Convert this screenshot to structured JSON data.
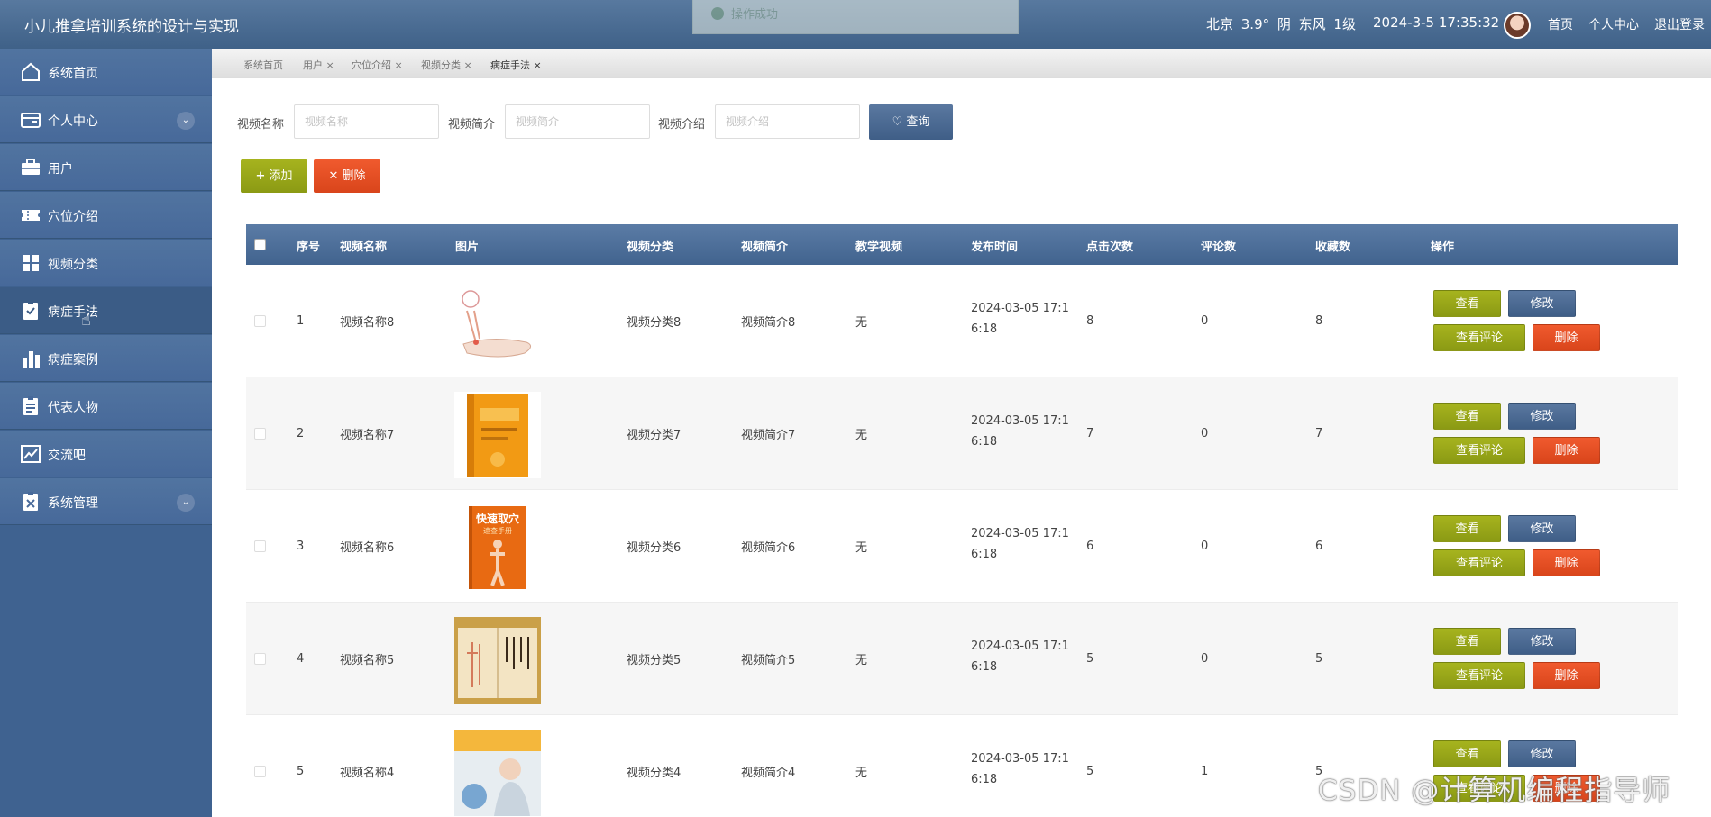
{
  "header": {
    "title": "小儿推拿培训系统的设计与实现",
    "toast": "操作成功",
    "weather": "北京 3.9° 阴 东风 1级",
    "datetime": "2024-3-5 17:35:32",
    "links": [
      "首页",
      "个人中心",
      "退出登录"
    ]
  },
  "sidebar": {
    "items": [
      {
        "label": "系统首页",
        "icon": "home-icon"
      },
      {
        "label": "个人中心",
        "icon": "wallet-icon",
        "expandable": true
      },
      {
        "label": "用户",
        "icon": "briefcase-icon"
      },
      {
        "label": "穴位介绍",
        "icon": "ticket-icon"
      },
      {
        "label": "视频分类",
        "icon": "grid-icon"
      },
      {
        "label": "病症手法",
        "icon": "clipboard-check-icon",
        "active": true
      },
      {
        "label": "病症案例",
        "icon": "bar-chart-icon"
      },
      {
        "label": "代表人物",
        "icon": "clipboard-list-icon"
      },
      {
        "label": "交流吧",
        "icon": "trend-icon"
      },
      {
        "label": "系统管理",
        "icon": "clipboard-x-icon",
        "expandable": true
      }
    ]
  },
  "tabs": [
    "系统首页",
    "用户 ×",
    "穴位介绍 ×",
    "视频分类 ×",
    "病症手法 ×"
  ],
  "search": {
    "fields": [
      {
        "label": "视频名称",
        "placeholder": "视频名称"
      },
      {
        "label": "视频简介",
        "placeholder": "视频简介"
      },
      {
        "label": "视频介绍",
        "placeholder": "视频介绍"
      }
    ],
    "query_label": "查询"
  },
  "actions": {
    "add_label": "添加",
    "delete_label": "删除"
  },
  "table": {
    "headers": [
      "序号",
      "视频名称",
      "图片",
      "视频分类",
      "视频简介",
      "教学视频",
      "发布时间",
      "点击次数",
      "评论数",
      "收藏数",
      "操作"
    ],
    "row_buttons": {
      "view": "查看",
      "edit": "修改",
      "comments": "查看评论",
      "delete": "删除"
    },
    "rows": [
      {
        "index": "1",
        "name": "视频名称8",
        "category": "视频分类8",
        "intro": "视频简介8",
        "video": "无",
        "time_a": "2024-03-05 17:1",
        "time_b": "6:18",
        "clicks": "8",
        "comments": "0",
        "favorites": "8",
        "image": "arm-acupoint"
      },
      {
        "index": "2",
        "name": "视频名称7",
        "category": "视频分类7",
        "intro": "视频简介7",
        "video": "无",
        "time_a": "2024-03-05 17:1",
        "time_b": "6:18",
        "clicks": "7",
        "comments": "0",
        "favorites": "7",
        "image": "yellow-book"
      },
      {
        "index": "3",
        "name": "视频名称6",
        "category": "视频分类6",
        "intro": "视频简介6",
        "video": "无",
        "time_a": "2024-03-05 17:1",
        "time_b": "6:18",
        "clicks": "6",
        "comments": "0",
        "favorites": "6",
        "image": "orange-book",
        "image_title": "快速取穴",
        "image_subtitle": "速查手册"
      },
      {
        "index": "4",
        "name": "视频名称5",
        "category": "视频分类5",
        "intro": "视频简介5",
        "video": "无",
        "time_a": "2024-03-05 17:1",
        "time_b": "6:18",
        "clicks": "5",
        "comments": "0",
        "favorites": "5",
        "image": "open-book"
      },
      {
        "index": "5",
        "name": "视频名称4",
        "category": "视频分类4",
        "intro": "视频简介4",
        "video": "无",
        "time_a": "2024-03-05 17:1",
        "time_b": "6:18",
        "clicks": "5",
        "comments": "1",
        "favorites": "5",
        "image": "massage-photo"
      }
    ]
  },
  "watermark": "CSDN @计算机编程指导师",
  "colors": {
    "header": "#4a6b94",
    "sidebar": "#3f6290",
    "olive": "#99a61a",
    "red": "#e4502a",
    "blue": "#4d6b93"
  }
}
